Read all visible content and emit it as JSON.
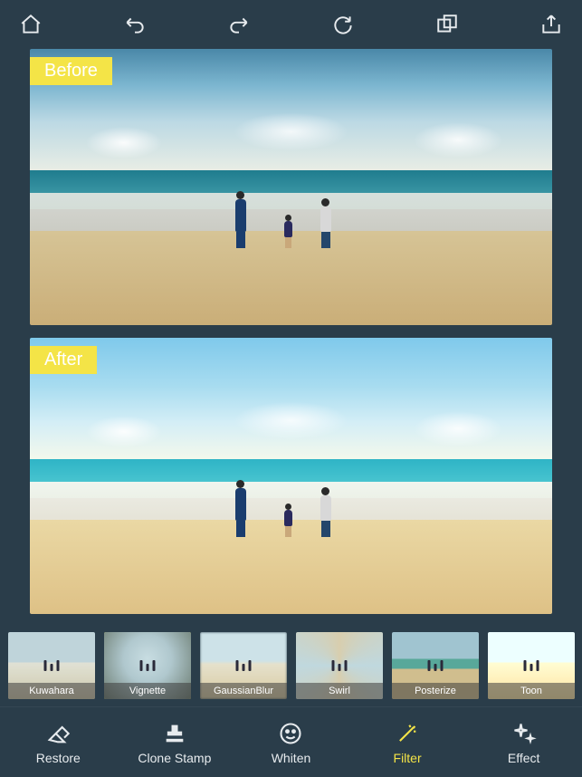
{
  "colors": {
    "bg": "#2a3d4a",
    "accent": "#f4e447",
    "icon": "#e7ebee"
  },
  "toolbar": {
    "home": "home",
    "undo": "undo",
    "redo": "redo",
    "refresh": "refresh",
    "compare": "compare",
    "share": "share"
  },
  "preview": {
    "before_label": "Before",
    "after_label": "After"
  },
  "filters": [
    {
      "id": "kuwahara",
      "label": "Kuwahara",
      "selected": false
    },
    {
      "id": "vignette",
      "label": "Vignette",
      "selected": true
    },
    {
      "id": "gaussianblur",
      "label": "GaussianBlur",
      "selected": false
    },
    {
      "id": "swirl",
      "label": "Swirl",
      "selected": false
    },
    {
      "id": "posterize",
      "label": "Posterize",
      "selected": false
    },
    {
      "id": "toon",
      "label": "Toon",
      "selected": false
    }
  ],
  "tabs": {
    "restore": "Restore",
    "clone_stamp": "Clone Stamp",
    "whiten": "Whiten",
    "filter": "Filter",
    "effect": "Effect",
    "active": "filter"
  }
}
